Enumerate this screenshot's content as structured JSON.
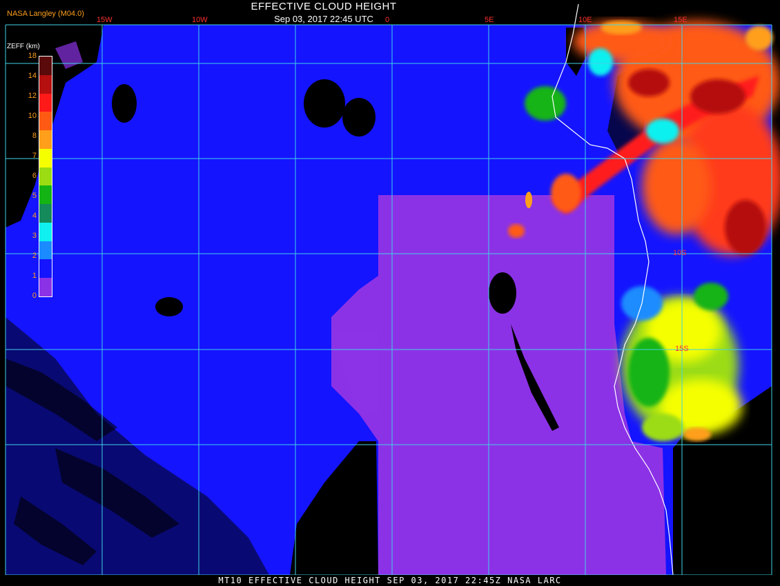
{
  "header": {
    "title": "EFFECTIVE CLOUD HEIGHT",
    "subtitle": "Sep 03, 2017 22:45 UTC",
    "agency": "NASA Langley (M04.0)"
  },
  "legend": {
    "unit": "ZEFF (km)",
    "ticks": [
      "18",
      "14",
      "12",
      "10",
      "8",
      "7",
      "6",
      "5",
      "4",
      "3",
      "2",
      "1",
      "0"
    ],
    "colors": [
      "#5a0a0a",
      "#b50f0f",
      "#ff1a1a",
      "#ff5a14",
      "#ff9f1a",
      "#f6ff00",
      "#9bdc12",
      "#14b414",
      "#158a5a",
      "#10f0f0",
      "#1a8cff",
      "#1414ff",
      "#8c32e6"
    ]
  },
  "grid": {
    "color": "#3fd3e6",
    "lon_labels": [
      "15W",
      "10W",
      "0",
      "5E",
      "10E",
      "15E"
    ],
    "lat_labels": [
      "10S",
      "15S"
    ]
  },
  "footer": {
    "text": "MT10  EFFECTIVE CLOUD HEIGHT   SEP 03, 2017 22:45Z   NASA LARC"
  }
}
